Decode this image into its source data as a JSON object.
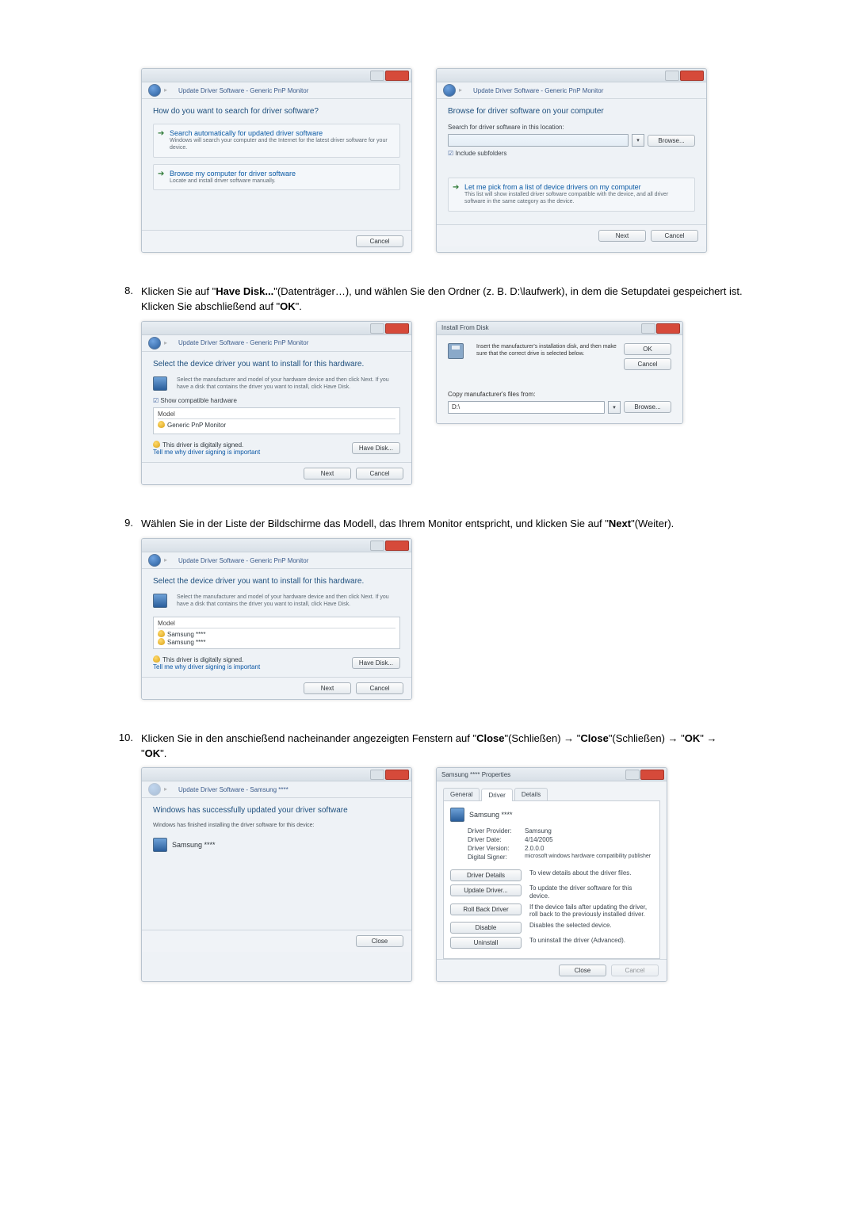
{
  "step7": {
    "left": {
      "nav_title": "Update Driver Software - Generic PnP Monitor",
      "heading": "How do you want to search for driver software?",
      "opt1_title": "Search automatically for updated driver software",
      "opt1_sub": "Windows will search your computer and the Internet for the latest driver software for your device.",
      "opt2_title": "Browse my computer for driver software",
      "opt2_sub": "Locate and install driver software manually.",
      "cancel": "Cancel"
    },
    "right": {
      "nav_title": "Update Driver Software - Generic PnP Monitor",
      "heading": "Browse for driver software on your computer",
      "search_label": "Search for driver software in this location:",
      "browse": "Browse...",
      "include_sub": "Include subfolders",
      "opt_title": "Let me pick from a list of device drivers on my computer",
      "opt_sub": "This list will show installed driver software compatible with the device, and all driver software in the same category as the device.",
      "next": "Next",
      "cancel": "Cancel"
    }
  },
  "step8": {
    "num": "8.",
    "text_before": "Klicken Sie auf \"",
    "bold1": "Have Disk...",
    "text_mid1": "\"(Datenträger…), und wählen Sie den Ordner (z. B. D:\\laufwerk), in dem die Setupdatei gespeichert ist. Klicken Sie abschließend auf \"",
    "bold2": "OK",
    "text_end": "\".",
    "left": {
      "nav_title": "Update Driver Software - Generic PnP Monitor",
      "heading": "Select the device driver you want to install for this hardware.",
      "instruct": "Select the manufacturer and model of your hardware device and then click Next. If you have a disk that contains the driver you want to install, click Have Disk.",
      "show_compat": "Show compatible hardware",
      "model_hdr": "Model",
      "model1": "Generic PnP Monitor",
      "signed": "This driver is digitally signed.",
      "tell_link": "Tell me why driver signing is important",
      "have_disk": "Have Disk...",
      "next": "Next",
      "cancel": "Cancel"
    },
    "right": {
      "title": "Install From Disk",
      "instruct": "Insert the manufacturer's installation disk, and then make sure that the correct drive is selected below.",
      "ok": "OK",
      "cancel": "Cancel",
      "copy_label": "Copy manufacturer's files from:",
      "path": "D:\\",
      "browse": "Browse..."
    }
  },
  "step9": {
    "num": "9.",
    "text_before": "Wählen Sie in der Liste der Bildschirme das Modell, das Ihrem Monitor entspricht, und klicken Sie auf \"",
    "bold1": "Next",
    "text_end": "\"(Weiter).",
    "shot": {
      "nav_title": "Update Driver Software - Generic PnP Monitor",
      "heading": "Select the device driver you want to install for this hardware.",
      "instruct": "Select the manufacturer and model of your hardware device and then click Next. If you have a disk that contains the driver you want to install, click Have Disk.",
      "model_hdr": "Model",
      "model1": "Samsung ****",
      "model2": "Samsung ****",
      "signed": "This driver is digitally signed.",
      "tell_link": "Tell me why driver signing is important",
      "have_disk": "Have Disk...",
      "next": "Next",
      "cancel": "Cancel"
    }
  },
  "step10": {
    "num": "10.",
    "text_before": "Klicken Sie in den anschießend nacheinander angezeigten Fenstern auf \"",
    "bold1": "Close",
    "text_a1": "\"(Schließen) → \"",
    "bold2": "Close",
    "text_a2": "\"(Schließen) → \"",
    "bold3": "OK",
    "text_a3": "\" → \"",
    "bold4": "OK",
    "text_end": "\".",
    "left": {
      "nav_title": "Update Driver Software - Samsung ****",
      "heading": "Windows has successfully updated your driver software",
      "sub": "Windows has finished installing the driver software for this device:",
      "device": "Samsung ****",
      "close": "Close"
    },
    "right": {
      "title": "Samsung **** Properties",
      "tab1": "General",
      "tab2": "Driver",
      "tab3": "Details",
      "device": "Samsung ****",
      "provider_k": "Driver Provider:",
      "provider_v": "Samsung",
      "date_k": "Driver Date:",
      "date_v": "4/14/2005",
      "version_k": "Driver Version:",
      "version_v": "2.0.0.0",
      "signer_k": "Digital Signer:",
      "signer_v": "microsoft windows hardware compatibility publisher",
      "btn_details": "Driver Details",
      "desc_details": "To view details about the driver files.",
      "btn_update": "Update Driver...",
      "desc_update": "To update the driver software for this device.",
      "btn_rollback": "Roll Back Driver",
      "desc_rollback": "If the device fails after updating the driver, roll back to the previously installed driver.",
      "btn_disable": "Disable",
      "desc_disable": "Disables the selected device.",
      "btn_uninstall": "Uninstall",
      "desc_uninstall": "To uninstall the driver (Advanced).",
      "close": "Close",
      "cancel": "Cancel"
    }
  }
}
